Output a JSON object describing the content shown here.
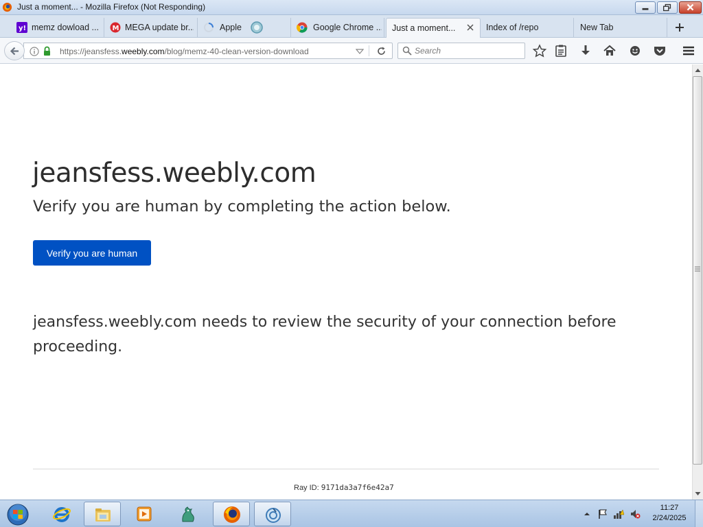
{
  "window": {
    "title": "Just a moment... - Mozilla Firefox (Not Responding)"
  },
  "tabs": [
    {
      "label": "memz dowload ...",
      "icon": "yahoo-icon"
    },
    {
      "label": "MEGA update br...",
      "icon": "mega-icon"
    },
    {
      "label": "Apple",
      "icon": "loading-spinner-icon"
    },
    {
      "label": "Google Chrome ...",
      "icon": "chrome-icon"
    },
    {
      "label": "Just a moment...",
      "icon": "none",
      "active": true
    },
    {
      "label": "Index of /repo",
      "icon": "none"
    },
    {
      "label": "New Tab",
      "icon": "none"
    }
  ],
  "navbar": {
    "url_prefix": "https://jeansfess.",
    "url_host": "weebly.com",
    "url_path": "/blog/memz-40-clean-version-download",
    "search_placeholder": "Search"
  },
  "page": {
    "site": "jeansfess.weebly.com",
    "subtitle": "Verify you are human by completing the action below.",
    "verify_button": "Verify you are human",
    "security_text": "jeansfess.weebly.com needs to review the security of your connection before proceeding.",
    "ray_label": "Ray ID:",
    "ray_id": "9171da3a7f6e42a7"
  },
  "taskbar": {
    "items": [
      "start-orb-icon",
      "internet-explorer-icon",
      "file-explorer-icon",
      "media-player-icon",
      "dragon-app-icon",
      "firefox-icon",
      "scanner-app-icon"
    ],
    "clock_time": "11:27",
    "clock_date": "2/24/2025"
  },
  "colors": {
    "accent": "#0051c3",
    "text": "#333333"
  }
}
